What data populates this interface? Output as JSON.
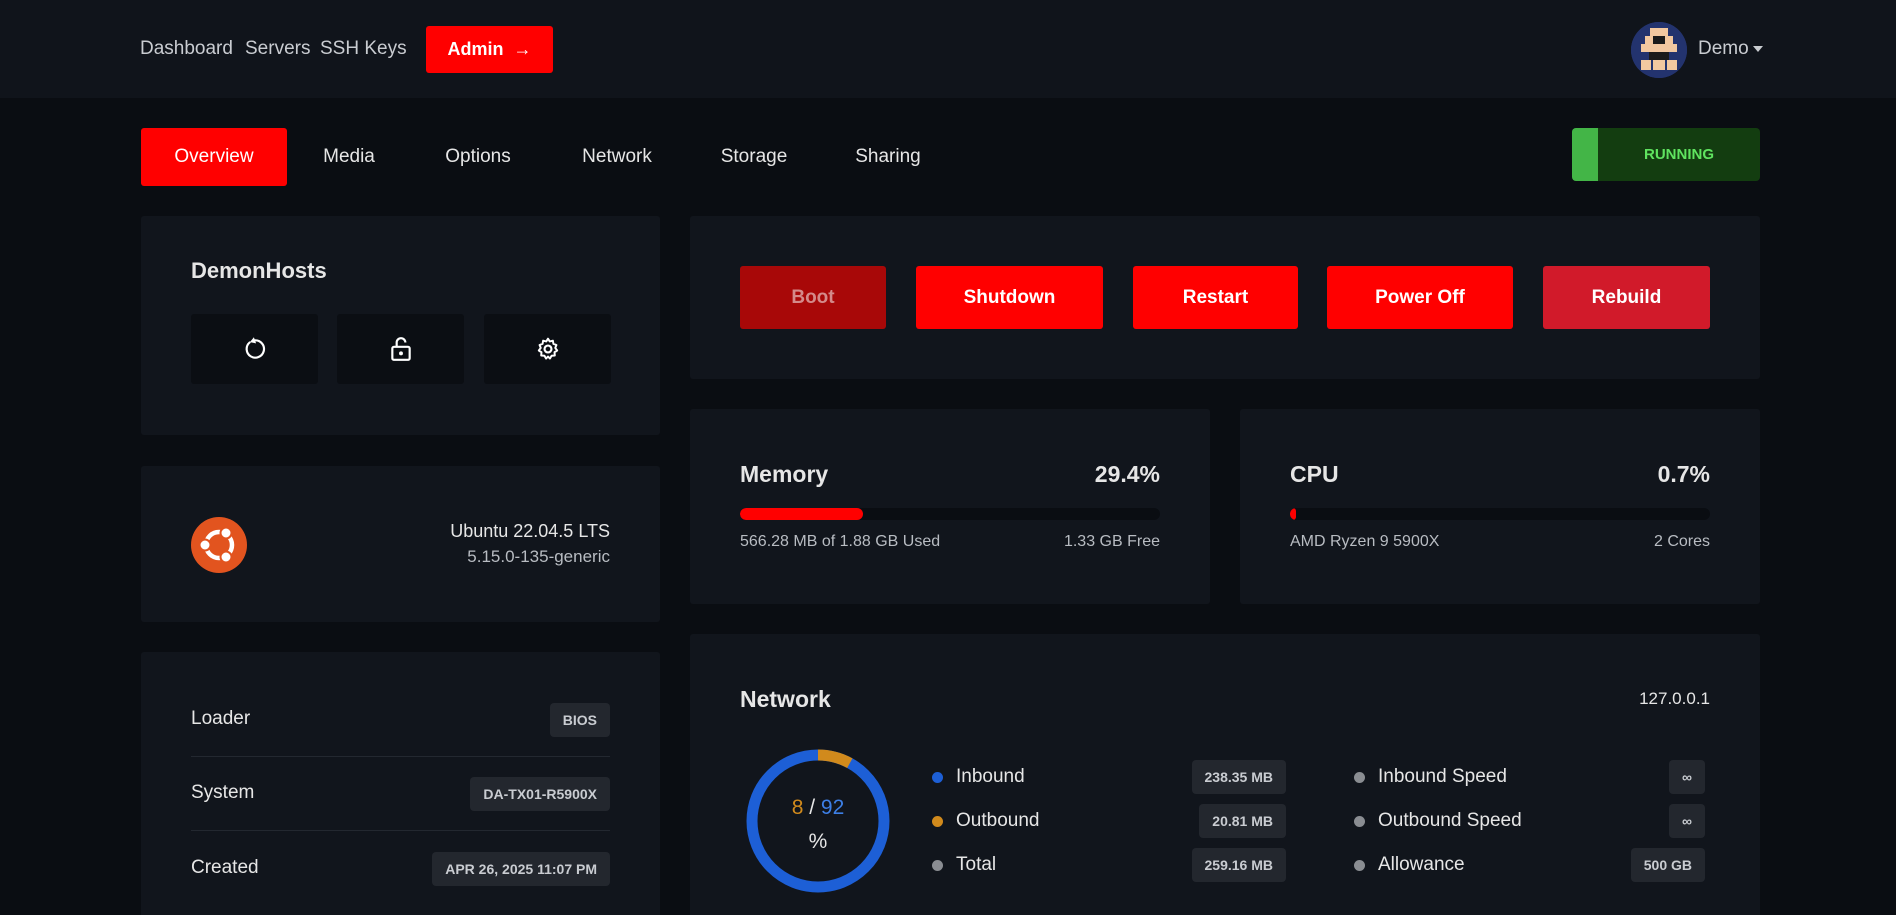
{
  "nav": {
    "links": [
      "Dashboard",
      "Servers",
      "SSH Keys"
    ],
    "admin_label": "Admin",
    "admin_arrow": "→",
    "user": "Demo"
  },
  "tabs": [
    "Overview",
    "Media",
    "Options",
    "Network",
    "Storage",
    "Sharing"
  ],
  "status": "RUNNING",
  "server": {
    "name": "DemonHosts",
    "icons": [
      "refresh-icon",
      "unlock-icon",
      "gear-icon"
    ]
  },
  "os": {
    "name": "Ubuntu 22.04.5 LTS",
    "kernel": "5.15.0-135-generic",
    "icon": "ubuntu-logo"
  },
  "details": [
    {
      "label": "Loader",
      "value": "BIOS"
    },
    {
      "label": "System",
      "value": "DA-TX01-R5900X"
    },
    {
      "label": "Created",
      "value": "APR 26, 2025 11:07 PM"
    }
  ],
  "actions": [
    "Boot",
    "Shutdown",
    "Restart",
    "Power Off",
    "Rebuild"
  ],
  "memory": {
    "title": "Memory",
    "percent": "29.4%",
    "fraction": 0.294,
    "used": "566.28 MB of 1.88 GB Used",
    "free": "1.33 GB Free"
  },
  "cpu": {
    "title": "CPU",
    "percent": "0.7%",
    "fraction": 0.007,
    "model": "AMD Ryzen 9 5900X",
    "cores": "2 Cores"
  },
  "network": {
    "title": "Network",
    "ip": "127.0.0.1",
    "donut": {
      "outbound_pct": "8",
      "slash": "/",
      "inbound_pct": "92",
      "unit": "%",
      "outbound_fraction": 0.08
    },
    "traffic": [
      {
        "label": "Inbound",
        "value": "238.35 MB",
        "color": "#1d5fd6"
      },
      {
        "label": "Outbound",
        "value": "20.81 MB",
        "color": "#d18a1c"
      },
      {
        "label": "Total",
        "value": "259.16 MB",
        "color": "#8a8d92"
      }
    ],
    "speeds": [
      {
        "label": "Inbound Speed",
        "value": "∞"
      },
      {
        "label": "Outbound Speed",
        "value": "∞"
      },
      {
        "label": "Allowance",
        "value": "500 GB"
      }
    ]
  },
  "colors": {
    "accent": "#ff0000",
    "running": "#43b547",
    "inbound": "#1d5fd6",
    "outbound": "#d18a1c"
  }
}
